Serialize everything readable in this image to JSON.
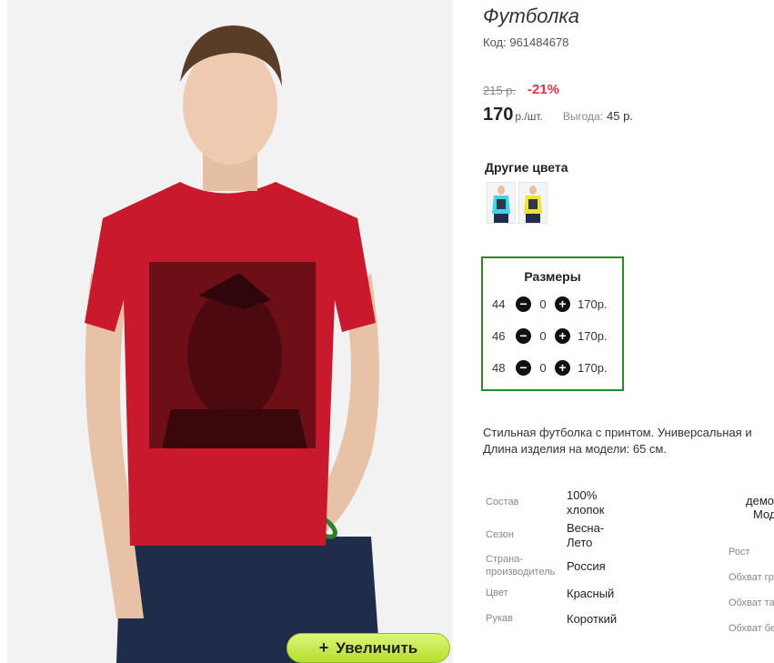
{
  "product": {
    "title": "Футболка",
    "code_label": "Код:",
    "code_value": "961484678",
    "old_price": "215 р.",
    "discount": "-21%",
    "price": "170",
    "price_unit": "р./шт.",
    "saving_label": "Выгода:",
    "saving_value": "45 р.",
    "zoom_plus": "+",
    "zoom_label": "Увеличить"
  },
  "colors": {
    "title": "Другие цвета",
    "swatches": [
      {
        "name": "cyan",
        "hex": "#3fd4e8"
      },
      {
        "name": "yellow",
        "hex": "#f0e03a"
      }
    ]
  },
  "sizes": {
    "title": "Размеры",
    "rows": [
      {
        "size": "44",
        "qty": "0",
        "price": "170р."
      },
      {
        "size": "46",
        "qty": "0",
        "price": "170р."
      },
      {
        "size": "48",
        "qty": "0",
        "price": "170р."
      }
    ],
    "minus": "−",
    "plus": "+"
  },
  "description": {
    "line1": "Стильная футболка с принтом. Универсальная и",
    "line2": "Длина изделия на модели: 65 см."
  },
  "properties": [
    {
      "label": "Состав",
      "value": "100% хлопок"
    },
    {
      "label": "Сезон",
      "value": "Весна-Лето"
    },
    {
      "label": "Страна-производитель",
      "value": "Россия"
    },
    {
      "label": "Цвет",
      "value": "Красный"
    },
    {
      "label": "Рукав",
      "value": "Короткий"
    }
  ],
  "model": {
    "head1": "демо",
    "head2": "Мод",
    "labels": [
      "Рост",
      "Обхват гр",
      "Обхват та",
      "Обхват бе"
    ]
  },
  "theme": {
    "accent_green": "#2a8a2a",
    "discount_red": "#e0334a",
    "shirt_red": "#c9192c"
  }
}
